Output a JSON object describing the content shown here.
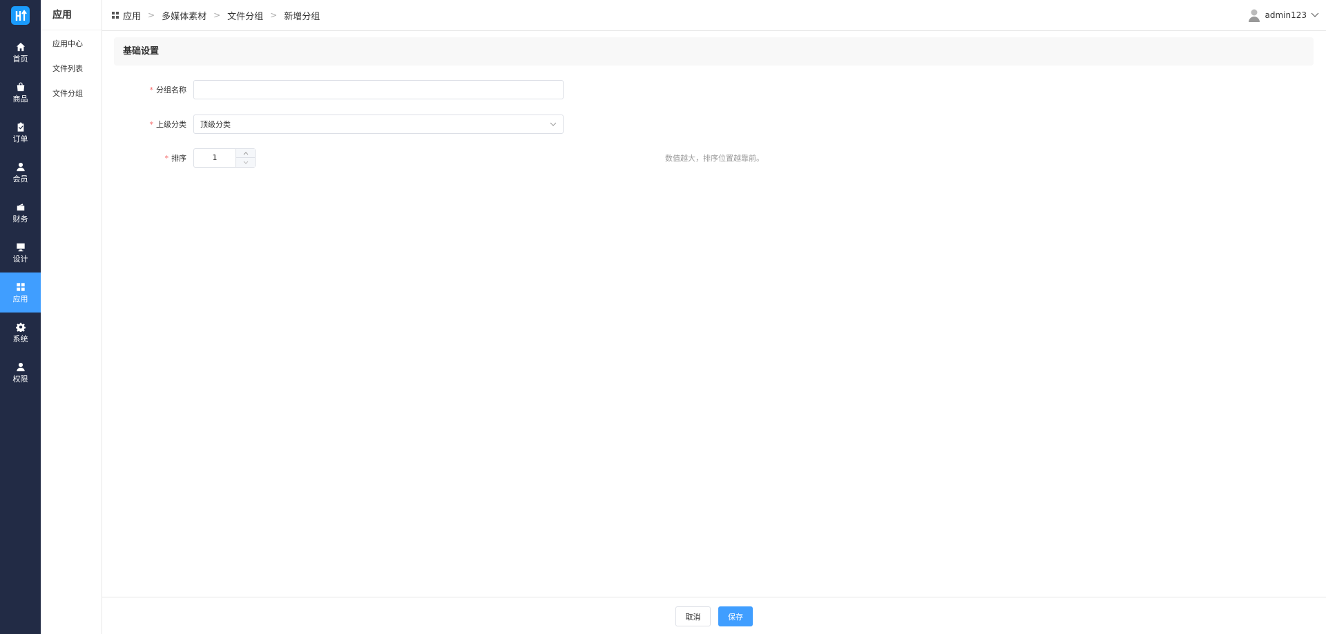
{
  "logo": {
    "text": "H"
  },
  "nav": {
    "items": [
      {
        "label": "首页",
        "icon": "home-icon"
      },
      {
        "label": "商品",
        "icon": "bag-icon"
      },
      {
        "label": "订单",
        "icon": "clipboard-icon"
      },
      {
        "label": "会员",
        "icon": "user-icon"
      },
      {
        "label": "财务",
        "icon": "wallet-icon"
      },
      {
        "label": "设计",
        "icon": "monitor-icon"
      },
      {
        "label": "应用",
        "icon": "apps-grid-icon",
        "active": true
      },
      {
        "label": "系统",
        "icon": "gear-icon"
      },
      {
        "label": "权限",
        "icon": "user-lock-icon"
      }
    ],
    "active_color": "#409eff",
    "bg_color": "#222b45"
  },
  "submenu": {
    "title": "应用",
    "items": [
      "应用中心",
      "文件列表",
      "文件分组"
    ]
  },
  "breadcrumb": {
    "icon": "apps-grid-icon",
    "items": [
      "应用",
      "多媒体素材",
      "文件分组",
      "新增分组"
    ]
  },
  "user": {
    "name": "admin123"
  },
  "section": {
    "title": "基础设置"
  },
  "form": {
    "group_name": {
      "label": "分组名称",
      "value": "",
      "required": true
    },
    "parent": {
      "label": "上级分类",
      "value": "顶级分类",
      "required": true
    },
    "sort": {
      "label": "排序",
      "value": "1",
      "required": true,
      "hint": "数值越大，排序位置越靠前。"
    }
  },
  "footer": {
    "cancel_label": "取消",
    "save_label": "保存"
  }
}
